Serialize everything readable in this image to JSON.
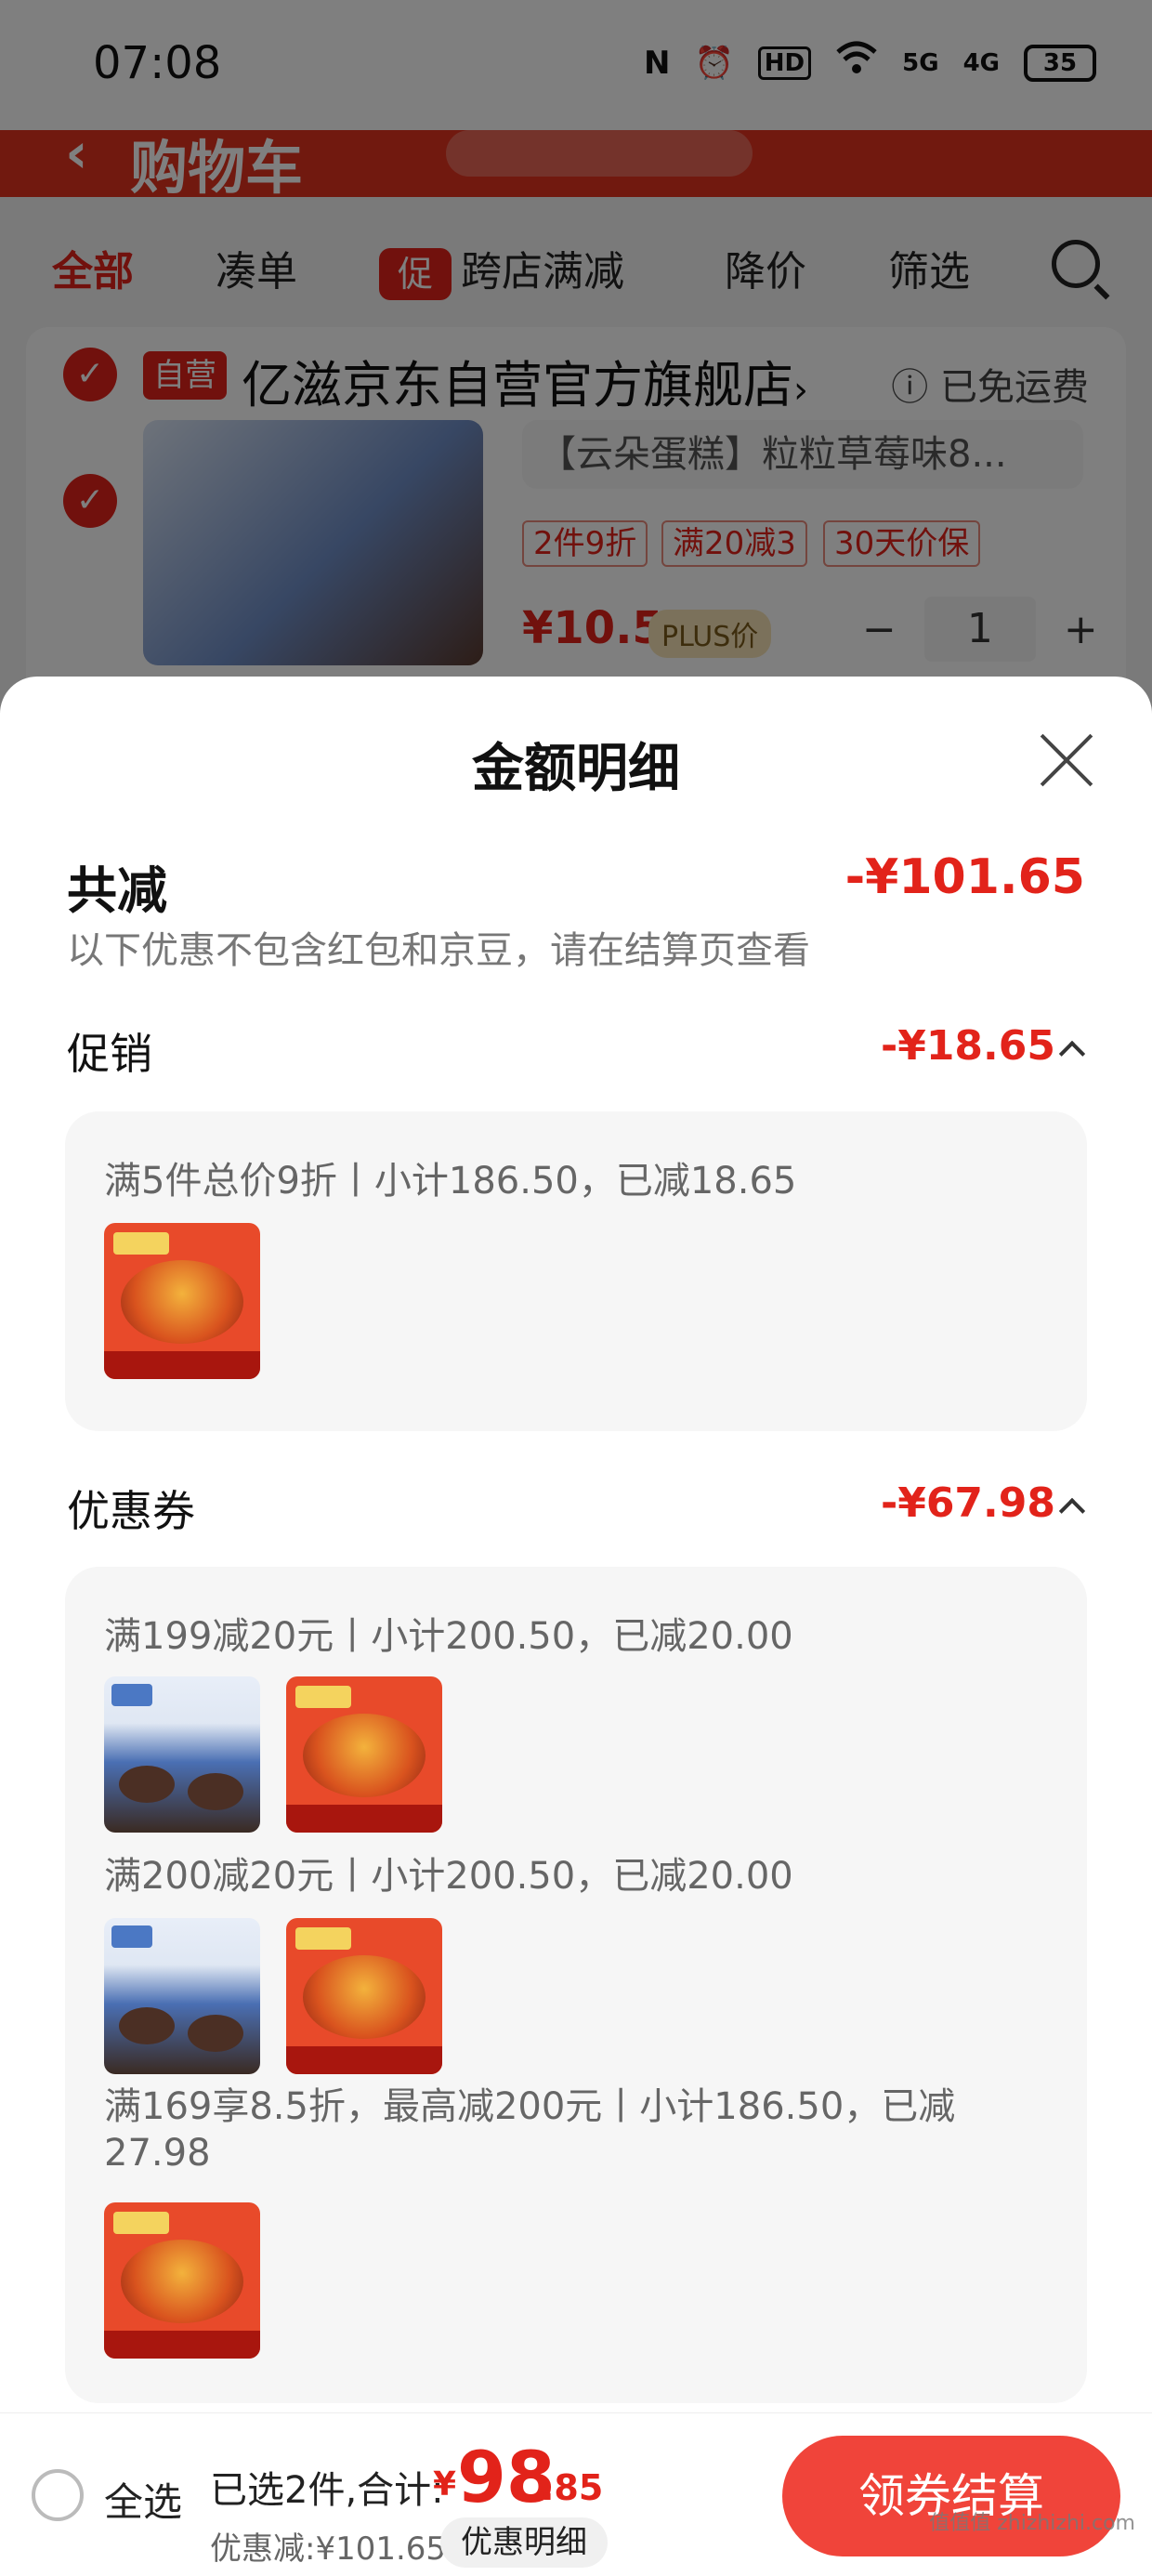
{
  "status_bar": {
    "time": "07:08",
    "icons": [
      "nfc-icon",
      "alarm-icon",
      "hd-icon",
      "wifi-icon",
      "signal-5g-icon",
      "signal-4g-icon"
    ],
    "nfc": "N",
    "hd": "HD",
    "net1": "5G",
    "net2": "4G",
    "battery": "35"
  },
  "background": {
    "header_title": "购物车",
    "filters": {
      "all": "全部",
      "combine": "凑单",
      "promo_badge": "促",
      "cross_store": "跨店满减",
      "price_drop": "降价",
      "filter": "筛选"
    },
    "shop": {
      "self_badge": "自营",
      "name": "亿滋京东自营官方旗舰店",
      "chevron": "›",
      "free_shipping": "ⓘ 已免运费",
      "product_title": "【云朵蛋糕】粒粒草莓味8...",
      "tags": [
        "2件9折",
        "满20减3",
        "30天价保"
      ],
      "price": "¥10.5",
      "plus_label": "PLUS价",
      "minus": "−",
      "quantity": "1",
      "plus": "+"
    }
  },
  "sheet": {
    "title": "金额明细",
    "total": {
      "label": "共减",
      "value": "-¥101.65",
      "note": "以下优惠不包含红包和京豆，请在结算页查看"
    },
    "promotion": {
      "label": "促销",
      "value": "-¥18.65",
      "rules": [
        {
          "text": "满5件总价9折丨小计186.50，已减18.65"
        }
      ]
    },
    "coupon": {
      "label": "优惠券",
      "value": "-¥67.98",
      "rules": [
        {
          "text": "满199减20元丨小计200.50，已减20.00"
        },
        {
          "text": "满200减20元丨小计200.50，已减20.00"
        },
        {
          "text": "满169享8.5折，最高减200元丨小计186.50，已减27.98"
        }
      ]
    }
  },
  "bottom_bar": {
    "select_all": "全选",
    "selected": "已选2件,合计:",
    "currency": "¥",
    "price_int": "98",
    "price_dec": ".85",
    "discount": "优惠减:¥101.65",
    "detail_button": "优惠明细",
    "checkout_button": "领券结算",
    "watermark": "值值值 zhizhizhi.com"
  },
  "colors": {
    "accent": "#e2231a",
    "checkout": "#f0443a",
    "sheet_bg": "#ffffff",
    "box_bg": "#f6f6f6"
  }
}
